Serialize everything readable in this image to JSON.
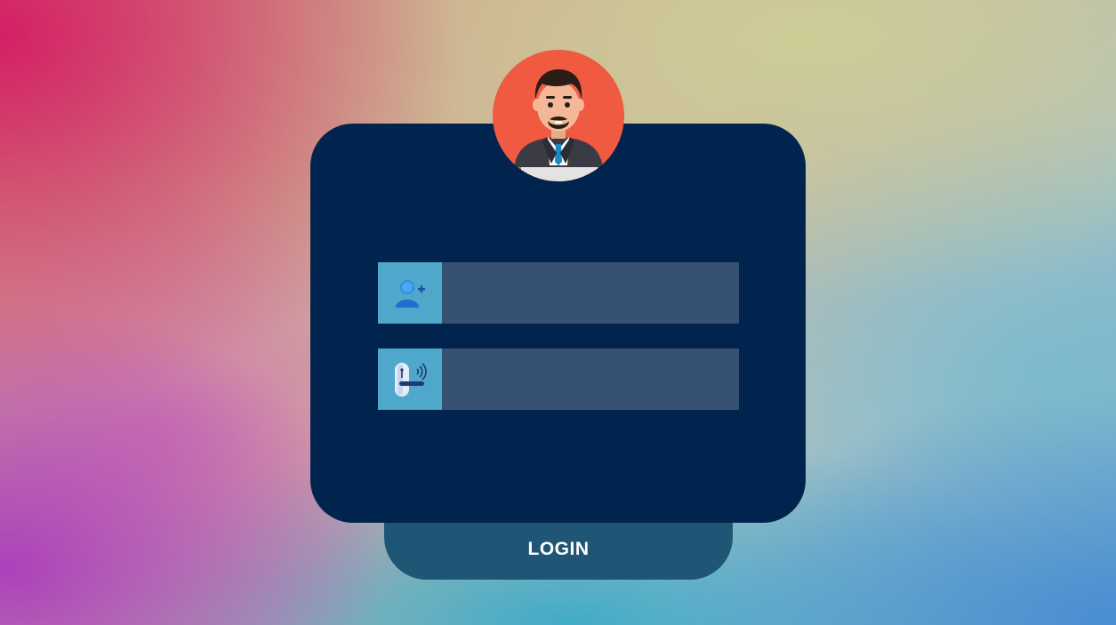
{
  "login_form": {
    "username": {
      "icon": "user-add-icon",
      "value": "",
      "placeholder": ""
    },
    "password": {
      "icon": "door-handle-key-icon",
      "value": "",
      "placeholder": ""
    },
    "login_button_label": "LOGIN"
  },
  "avatar": {
    "icon": "businessman-avatar"
  },
  "colors": {
    "card": "#00244d",
    "login_tab": "#1f5675",
    "avatar_bg": "#f05a40",
    "icon_cell": "#4fa8cc",
    "input_bg": "#375172"
  }
}
